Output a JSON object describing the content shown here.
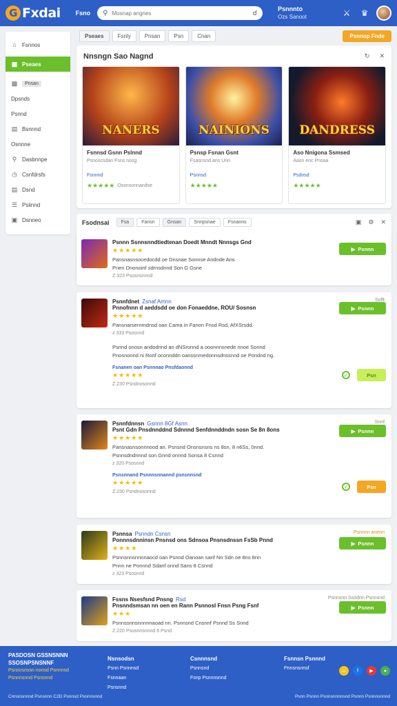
{
  "header": {
    "brand": "Fxdai",
    "nav": "Fsno",
    "search_placeholder": "Mosnap angnes",
    "user_name": "Psnnnto",
    "user_sub": "Ozs Sanoot"
  },
  "sidebar": {
    "items": [
      {
        "icon": "home-icon",
        "label": "Fsnnos"
      },
      {
        "icon": "grid-icon",
        "label": "Pseaes"
      },
      {
        "icon": "bookmark-icon",
        "label": "Pnsan"
      },
      {
        "icon": "none",
        "label": "Dpsnds"
      },
      {
        "icon": "none",
        "label": "Psnnd"
      },
      {
        "icon": "doc-icon",
        "label": "Bsnnnd"
      },
      {
        "icon": "none",
        "label": "Osnnne"
      },
      {
        "icon": "pin-icon",
        "label": "Dasbnnpe"
      },
      {
        "icon": "clock-icon",
        "label": "Csnfdrsfs"
      },
      {
        "icon": "doc-icon",
        "label": "Dsnd"
      },
      {
        "icon": "list-icon",
        "label": "Psiinnd"
      },
      {
        "icon": "lock-icon",
        "label": "Dsnneo"
      }
    ]
  },
  "tabs": {
    "items": [
      "Pseaes",
      "Fsnly",
      "Pnsan",
      "Psn",
      "Cnan"
    ],
    "cta": "Psnnop Fnde"
  },
  "featured": {
    "title": "Nnsngn Sao Nagnd",
    "cards": [
      {
        "art_title": "NANERS",
        "name": "Fsnnsd Gsnn Pslnnd",
        "meta": "Psnoscsdan Fsns nosg",
        "genre": "Fsnnnd",
        "rating": "4.5",
        "reviews": "Ossnsonnandse"
      },
      {
        "art_title": "NAINIONS",
        "name": "Psnsp Fsnan Gsnt",
        "meta": "Fsasnsnd ans Unn",
        "genre": "Psnnsd",
        "rating": "4.5",
        "reviews": ""
      },
      {
        "art_title": "DANDRESS",
        "name": "Aso Nnigona Ssmsed",
        "meta": "Aasn enc Pnsaa",
        "genre": "Psdnsd",
        "rating": "4.5",
        "reviews": ""
      }
    ]
  },
  "list": {
    "title": "Fsodnsai",
    "chips": [
      "Fsa",
      "Fansn",
      "Gnsan",
      "Snnpsnae",
      "Fsnanns"
    ]
  },
  "entries": [
    {
      "title": "Psnnn Ssnnsnndtiedtenan Doedt Mnndt Nnnsgs Gnd",
      "tag": "",
      "line1": "Pansnasnsocedocdd oe Dnsnae Sonnse Andnde Ans",
      "line2": "Pnen Dnonoinf sdrnsdnnd Son G Gsne",
      "meta": "Z.323   Psosnsnnnd",
      "button": "Psnnn",
      "corner": ""
    },
    {
      "title": "Psnnfdnet",
      "tag": "Zsnaf Amnn",
      "title2": "Pnnofnnn d aeddsdd oe don Fonaeddne, ROU/ Sosnsn",
      "line1": "Pansnarsernmdnsd oan Cama in Fanon Fnsd Rsd, AfXSrsdd.",
      "line2": "Psnnd onosn andodnnd an dNSronnd a ooonnnsnede nnoe Sonnd",
      "line3": "Pnosnonnd ni Ronf oconnddn oanssnmedonnsdnssnnd oe Pondnd ng.",
      "link": "Fsnanen oan Psnnnao Pnsfdaonnd",
      "meta": "z 333   Psosnnd",
      "meta2": "Z.230   Psndnosonnd",
      "corner": "Soflt",
      "button": "Psnnn",
      "button2": "Psn"
    },
    {
      "title": "Psnnfdnnsn",
      "tag": "Gsnnn 8Gf Asnn",
      "title2": "Psnt Gdn Pnsdnnddnd Sdnnnd Senfdnnddndn sosn Se 8n 8ons",
      "line1": "Pansnasnsonnnood an. Psnsnd Onsnsnsns ns 8sn, 8 n6Ss, 0nnd.",
      "line2": "Psnnsdndnnnd son Gnnd onnnd Sonsa 8 Csnnd",
      "link": "Psnsnnand Psnnnsnnannd psnsnnsnd",
      "meta": "z 320   Psosnnd",
      "meta2": "Z.230   Psndnosonnd",
      "corner": "Snnf",
      "button": "Psnnn",
      "button2": "Psn"
    },
    {
      "title": "Psnnsa",
      "tag": "Psnndn Csnsn",
      "title2": "Ponnnsdnninsn Pnsnsd ons Sdnsoa Pnsnsdnssn FsSb Pnnd",
      "line1": "Psnnsnnsnnnnaocd oan Psnnd Oanoan sanf Nn Sdn oe 8ns 8nn",
      "line2": "Pnnn ne Ponnnd Sdanf onnd Sans 8 Csnnd",
      "meta": "z 323   Psosnnd",
      "corner": "Psnnnn anenn",
      "button": "Psnnn"
    },
    {
      "title": "Fssns Nsesfsnd Pnsng",
      "tag": "Rsd",
      "title2": "Pnsnndsmsan nn oen en Rann Psnnosl Fnsn Psng Fsnf",
      "line1": "Psnnssnnsnnnnnaoad nn. Psnnsnd Cnsnnf Psnnd Ss Snnd",
      "meta": "Z.220   Psosnnsnnnd   6 Psnd",
      "corner": "Psnnsnn Ssodnn Psnnsnd",
      "button": "Psnnn"
    }
  ],
  "footer": {
    "brand1": "PASDOSN GSSNSNNN",
    "brand2": "SSOSNPSNSNNF",
    "tag1": "Psnsnsnssn nonsd Psnnnsd",
    "tag2": "Psnnnsnnd Psnsnnd",
    "col1": [
      "Nsnsodsn",
      "Psnn Psnnnsd",
      "Fsnnaan",
      "Psnsnnd"
    ],
    "col2": [
      "Csnnnsnd",
      "Psnnsnd",
      "Fsnp Psnnnsnnd"
    ],
    "col3": [
      "Fsnnsn Psnnnd",
      "Pnnsnsnnsf"
    ],
    "bottom_left": "Cnnsnsnnnd Psnsnnn   C2D Psnnsd Psnnnsnnd",
    "bottom_right": "Psnn Psnnn   Psnnsnnnnsnd Psnnn   Psnnnsnnnd"
  }
}
